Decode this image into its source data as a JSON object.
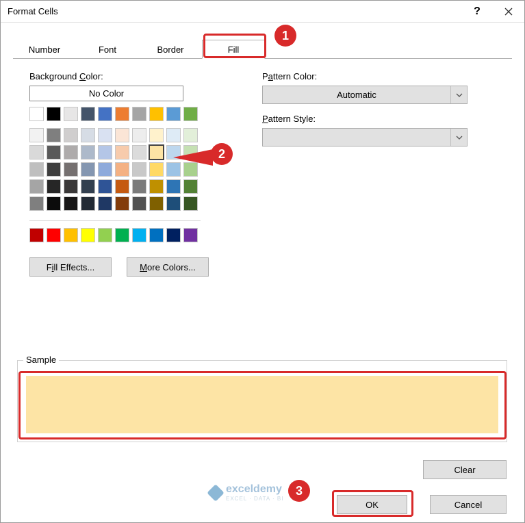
{
  "title": "Format Cells",
  "tabs": [
    "Number",
    "Font",
    "Border",
    "Fill"
  ],
  "active_tab": 3,
  "bg_label": "Background Color:",
  "no_color": "No Color",
  "fill_effects": "Fill Effects...",
  "more_colors": "More Colors...",
  "pattern_color_label": "Pattern Color:",
  "pattern_color_value": "Automatic",
  "pattern_style_label": "Pattern Style:",
  "pattern_style_value": "",
  "sample_label": "Sample",
  "clear": "Clear",
  "ok": "OK",
  "cancel": "Cancel",
  "selected_color": "#fde4a5",
  "theme_colors": [
    "#ffffff",
    "#000000",
    "#e7e6e6",
    "#44546a",
    "#4472c4",
    "#ed7d31",
    "#a5a5a5",
    "#ffc000",
    "#5b9bd5",
    "#70ad47"
  ],
  "tint_matrix": [
    [
      "#f2f2f2",
      "#7f7f7f",
      "#d0cece",
      "#d6dce5",
      "#d9e1f2",
      "#fbe5d6",
      "#ededed",
      "#fff2cc",
      "#deebf6",
      "#e2efd9"
    ],
    [
      "#d9d9d9",
      "#595959",
      "#aeabab",
      "#adb9ca",
      "#b4c6e7",
      "#f7cbac",
      "#dbdbdb",
      "#fde4a5",
      "#bdd7ee",
      "#c5e0b3"
    ],
    [
      "#bfbfbf",
      "#3f3f3f",
      "#757070",
      "#8496b0",
      "#8eaadb",
      "#f4b183",
      "#c9c9c9",
      "#ffd965",
      "#9cc3e5",
      "#a8d08d"
    ],
    [
      "#a5a5a5",
      "#262626",
      "#3a3838",
      "#323f4f",
      "#2f5496",
      "#c55a11",
      "#7b7b7b",
      "#bf9000",
      "#2e75b5",
      "#538135"
    ],
    [
      "#7f7f7f",
      "#0c0c0c",
      "#171616",
      "#222a35",
      "#1f3864",
      "#833c0b",
      "#525252",
      "#7f6000",
      "#1e4e79",
      "#375623"
    ]
  ],
  "standard_colors": [
    "#c00000",
    "#ff0000",
    "#ffc000",
    "#ffff00",
    "#92d050",
    "#00b050",
    "#00b0f0",
    "#0070c0",
    "#002060",
    "#7030a0"
  ],
  "callouts": {
    "c1": "1",
    "c2": "2",
    "c3": "3"
  },
  "watermark": {
    "name": "exceldemy",
    "tag": "EXCEL · DATA · BI"
  }
}
